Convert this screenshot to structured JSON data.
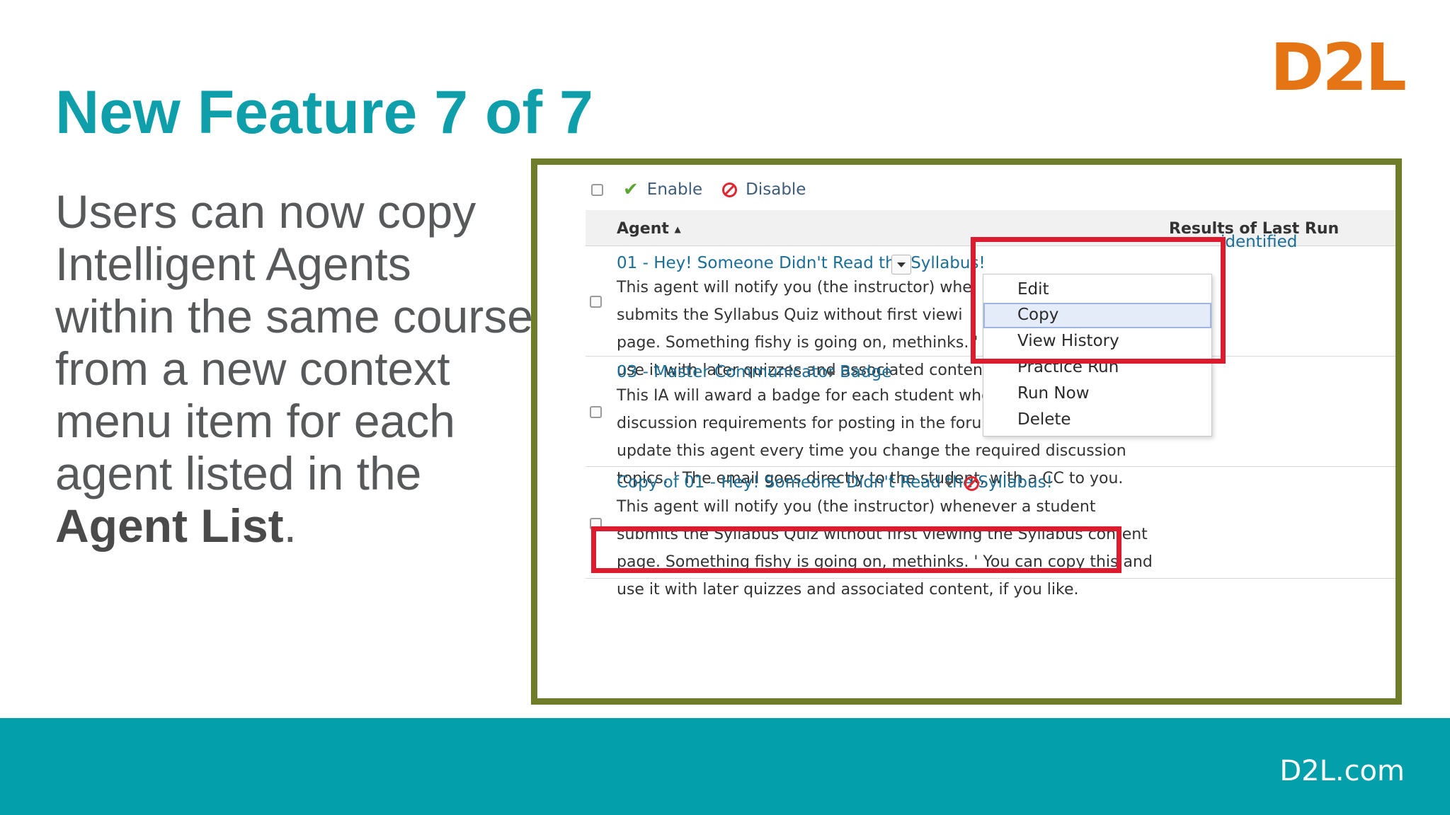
{
  "slide": {
    "title": "New Feature 7 of 7",
    "description_part1": "Users can now copy Intelligent Agents within the same course from a new context menu item for each agent listed in the ",
    "description_bold": "Agent List",
    "description_end": ".",
    "logo": "D2L",
    "footer": "D2L.com"
  },
  "colors": {
    "title": "#0f9fab",
    "logo": "#e57514",
    "footer_bar": "#03a0ab",
    "frame_border": "#6f7c2a",
    "highlight": "#dc1b2e"
  },
  "toolbar": {
    "enable_label": "Enable",
    "disable_label": "Disable",
    "enable_icon": "checkmark-icon",
    "disable_icon": "ban-icon"
  },
  "table": {
    "col_agent": "Agent",
    "sort_indicator": "▲",
    "col_results": "Results of Last Run",
    "rows": [
      {
        "name": "01 - Hey! Someone Didn't Read the Syllabus!",
        "description": [
          "This agent will notify you (the instructor) whe",
          "submits the Syllabus Quiz without first viewi",
          "page. Something fishy is going on, methinks. '",
          "use it with later quizzes and associated conten"
        ],
        "result": "identified"
      },
      {
        "name": "03 - Master Communicator Badge",
        "description": [
          "This IA will award a badge for each student who completes all of the",
          "discussion requirements for posting in the forums. ' You may need to",
          "update this agent every time you change the required discussion",
          "topics. ' The email goes directly to the student, with a CC to you."
        ]
      },
      {
        "name": "Copy of 01 - Hey! Someone Didn't Read the Syllabus!",
        "description": [
          "This agent will notify you (the instructor) whenever a student",
          "submits the Syllabus Quiz without first viewing the Syllabus content",
          "page. Something fishy is going on, methinks. ' You can copy this and",
          "use it with later quizzes and associated content, if you like."
        ]
      }
    ]
  },
  "context_menu": {
    "items": [
      "Edit",
      "Copy",
      "View History",
      "Practice Run",
      "Run Now",
      "Delete"
    ],
    "selected": "Copy"
  }
}
